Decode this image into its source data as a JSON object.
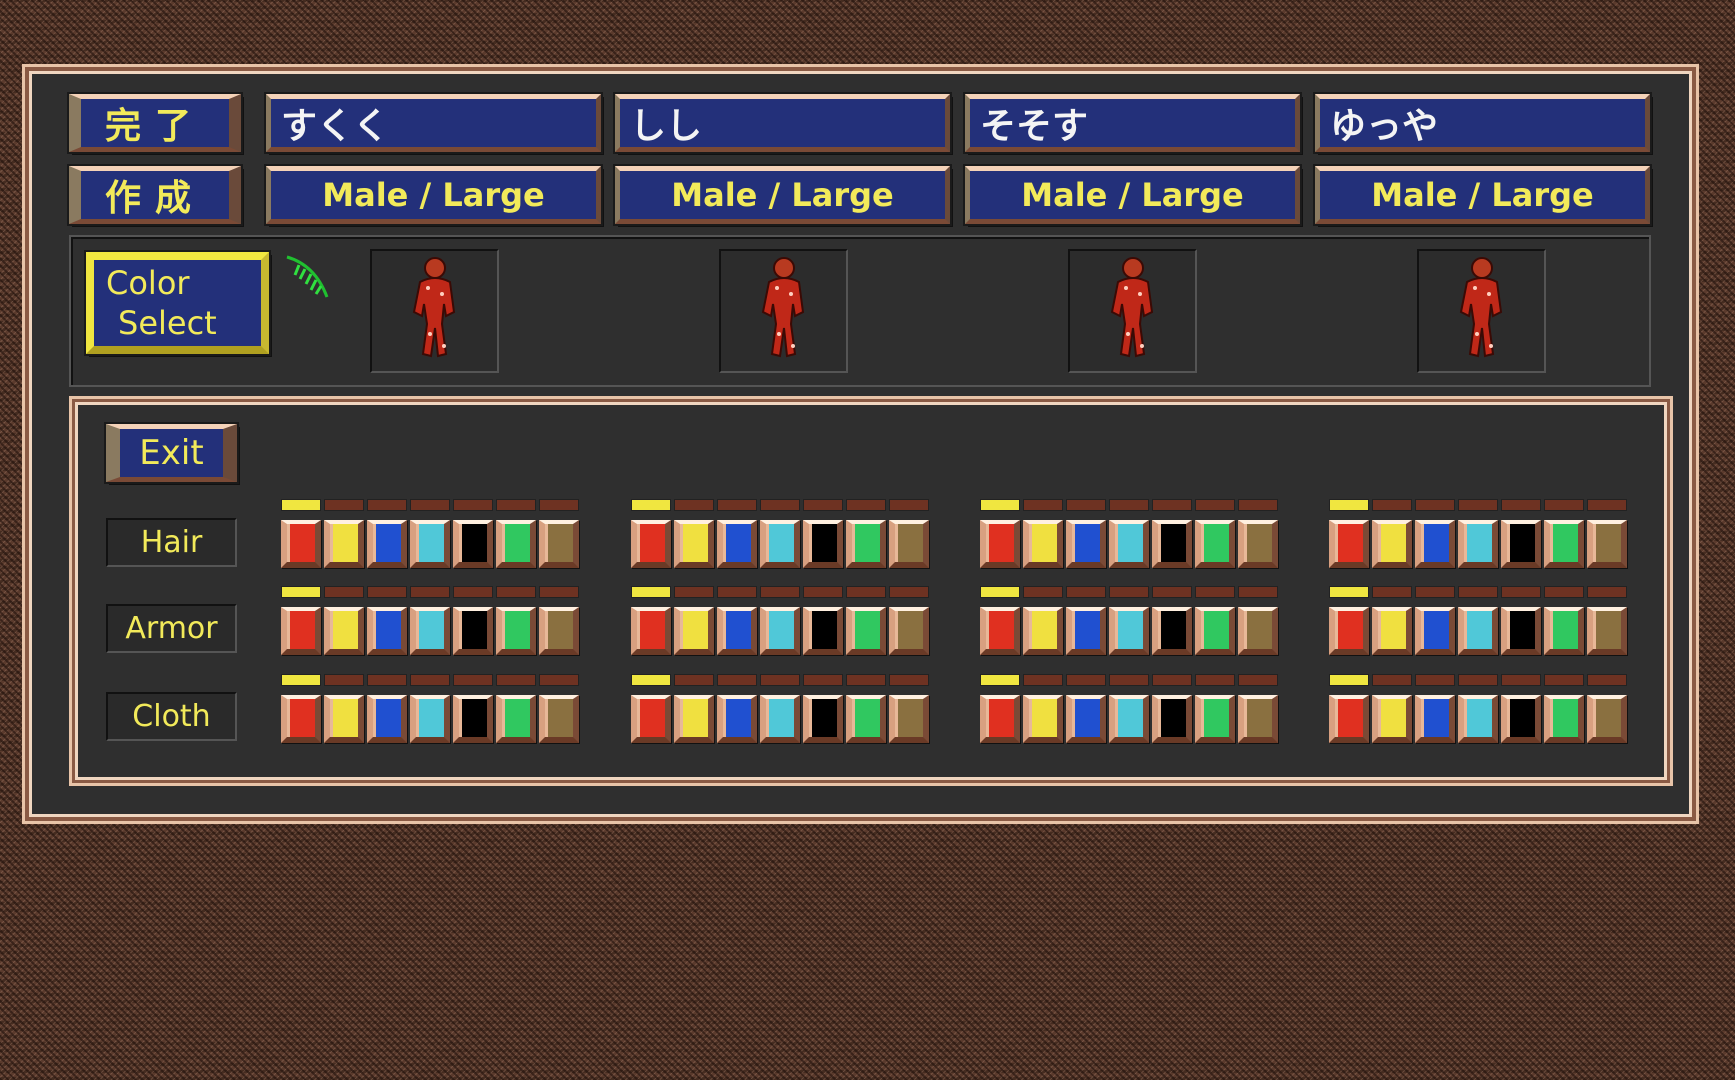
{
  "buttons": {
    "done": "完了",
    "create": "作成",
    "color_select_line1": "Color",
    "color_select_line2": "Select",
    "exit": "Exit"
  },
  "characters": [
    {
      "name": "すくく",
      "class": "Male / Large"
    },
    {
      "name": "しし",
      "class": "Male / Large"
    },
    {
      "name": "そそす",
      "class": "Male / Large"
    },
    {
      "name": "ゆっや",
      "class": "Male / Large"
    }
  ],
  "rows": [
    {
      "label": "Hair",
      "selected": 0
    },
    {
      "label": "Armor",
      "selected": 0
    },
    {
      "label": "Cloth",
      "selected": 0
    }
  ],
  "palette": [
    "#e03020",
    "#f0e040",
    "#2050d0",
    "#50c8d8",
    "#000000",
    "#30c860",
    "#8a7040"
  ],
  "cursor_icon": "green-feather-cursor"
}
